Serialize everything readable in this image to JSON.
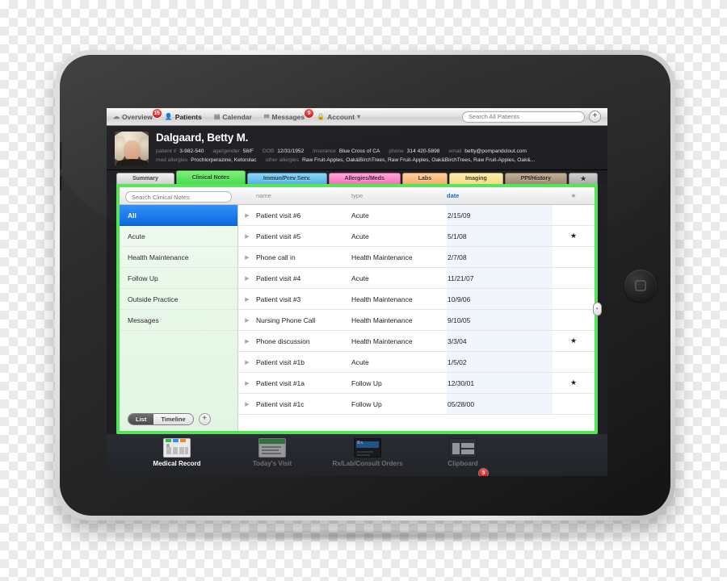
{
  "theme": {
    "panel_green": "#55e356",
    "accent_blue": "#0a66e0",
    "badge_red": "#d80f0f",
    "dock_bg": "#24262c"
  },
  "navbar": {
    "items": [
      {
        "label": "Overview",
        "icon": "cloud-icon",
        "badge": "15",
        "active": false
      },
      {
        "label": "Patients",
        "icon": "person-icon",
        "badge": "",
        "active": true
      },
      {
        "label": "Calendar",
        "icon": "calendar-icon",
        "badge": "",
        "active": false
      },
      {
        "label": "Messages",
        "icon": "envelope-icon",
        "badge": "9",
        "active": false
      },
      {
        "label": "Account",
        "icon": "lock-icon",
        "badge": "",
        "active": false,
        "caret": "▾"
      }
    ],
    "search_placeholder": "Search All Patients",
    "add_label": "+"
  },
  "patient": {
    "name": "Dalgaard, Betty M.",
    "fields_row1": [
      {
        "key": "patient #",
        "value": "3-982-540"
      },
      {
        "key": "age/gender",
        "value": "58/F"
      },
      {
        "key": "DOB",
        "value": "12/31/1952"
      },
      {
        "key": "insurance",
        "value": "Blue Cross of CA"
      },
      {
        "key": "phone",
        "value": "314 420-5898"
      },
      {
        "key": "email",
        "value": "betty@pompandclout.com"
      }
    ],
    "fields_row2": [
      {
        "key": "med allergies",
        "value": "Prochlorperazine, Ketorolac"
      },
      {
        "key": "other allergies",
        "value": "Raw Fruit-Apples, Oak&BirchTrees, Raw Fruit-Apples, Oak&BirchTrees, Raw Fruit-Apples, Oak&..."
      }
    ]
  },
  "tabs": [
    {
      "label": "Summary",
      "color": "#dcdcdc",
      "text": "#3a3a3a",
      "active": false
    },
    {
      "label": "Clinical Notes",
      "color": "#55e356",
      "text": "#143d14",
      "active": true
    },
    {
      "label": "Immun/Prev Serv.",
      "color": "#5bb8e8",
      "text": "#123a4c",
      "active": false
    },
    {
      "label": "Allergies/Meds",
      "color": "#f87fc0",
      "text": "#4c1236",
      "active": false
    },
    {
      "label": "Labs",
      "color": "#f8b878",
      "text": "#4c2c12",
      "active": false
    },
    {
      "label": "Imaging",
      "color": "#f8e08c",
      "text": "#4a4012",
      "active": false
    },
    {
      "label": "PPI/History",
      "color": "#a8947c",
      "text": "#2e2418",
      "active": false
    },
    {
      "label": "★",
      "color": "#b4b4b4",
      "text": "#2c2c2c",
      "active": false
    }
  ],
  "notes_panel": {
    "search_placeholder": "Search Clinical Notes",
    "columns": {
      "name": "name",
      "type": "type",
      "date": "date",
      "star": "★"
    },
    "sorted_column": "date",
    "sidebar": [
      {
        "label": "All",
        "active": true
      },
      {
        "label": "Acute",
        "active": false
      },
      {
        "label": "Health Maintenance",
        "active": false
      },
      {
        "label": "Follow Up",
        "active": false
      },
      {
        "label": "Outside Practice",
        "active": false
      },
      {
        "label": "Messages",
        "active": false
      }
    ],
    "view_toggle": {
      "options": [
        "List",
        "Timeline"
      ],
      "selected": "List"
    },
    "add_label": "+",
    "edge_handle": "‣",
    "rows": [
      {
        "disclosure": "▶",
        "name": "Patient visit #6",
        "type": "Acute",
        "date": "2/15/09",
        "star": ""
      },
      {
        "disclosure": "▶",
        "name": "Patient visit #5",
        "type": "Acute",
        "date": "5/1/08",
        "star": "★"
      },
      {
        "disclosure": "▶",
        "name": "Phone call in",
        "type": "Health Maintenance",
        "date": "2/7/08",
        "star": ""
      },
      {
        "disclosure": "▶",
        "name": "Patient visit #4",
        "type": "Acute",
        "date": "11/21/07",
        "star": ""
      },
      {
        "disclosure": "▶",
        "name": "Patient visit #3",
        "type": "Health Maintenance",
        "date": "10/9/06",
        "star": ""
      },
      {
        "disclosure": "▶",
        "name": "Nursing Phone Call",
        "type": "Health Maintenance",
        "date": "9/10/05",
        "star": ""
      },
      {
        "disclosure": "▶",
        "name": "Phone discussion",
        "type": "Health Maintenance",
        "date": "3/3/04",
        "star": "★"
      },
      {
        "disclosure": "▶",
        "name": "Patient visit #1b",
        "type": "Acute",
        "date": "1/5/02",
        "star": ""
      },
      {
        "disclosure": "▶",
        "name": "Patient visit #1a",
        "type": "Follow Up",
        "date": "12/30/01",
        "star": "★"
      },
      {
        "disclosure": "▶",
        "name": "Patient visit #1c",
        "type": "Follow Up",
        "date": "05/28/00",
        "star": ""
      }
    ]
  },
  "dock": [
    {
      "label": "Medical Record",
      "icon": "medical-record-icon",
      "active": true,
      "badge": ""
    },
    {
      "label": "Today's Visit",
      "icon": "todays-visit-icon",
      "active": false,
      "badge": ""
    },
    {
      "label": "Rx/Lab/Consult Orders",
      "icon": "rx-orders-icon",
      "active": false,
      "badge": ""
    },
    {
      "label": "Clipboard",
      "icon": "clipboard-icon",
      "active": false,
      "badge": "3"
    }
  ]
}
